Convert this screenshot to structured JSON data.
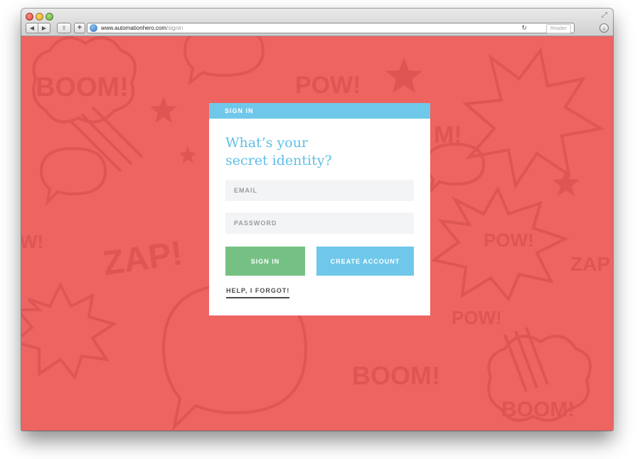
{
  "browser": {
    "url_host": "www.automationhero.com",
    "url_path": "/signin",
    "reader_label": "Reader",
    "icons": [
      "back-icon",
      "forward-icon",
      "share-icon",
      "add-bookmark-icon",
      "globe-icon",
      "reload-icon",
      "download-icon",
      "fullscreen-icon"
    ]
  },
  "background": {
    "color": "#ee6461",
    "words": [
      "BOOM!",
      "POW!",
      "ZAP!",
      "W!",
      "M!",
      "POW!",
      "ZAP",
      "POW!",
      "BOOM!",
      "BOOM!"
    ]
  },
  "signin": {
    "header": "SIGN IN",
    "title_line1": "What’s your",
    "title_line2": "secret identity?",
    "email_placeholder": "EMAIL",
    "password_placeholder": "PASSWORD",
    "signin_label": "SIGN IN",
    "create_label": "CREATE ACCOUNT",
    "forgot_label": "HELP, I FORGOT!"
  },
  "colors": {
    "accent_blue": "#6fc8ea",
    "signin_green": "#75c184",
    "field_bg": "#f3f4f6",
    "title_blue": "#5fbfe6"
  }
}
